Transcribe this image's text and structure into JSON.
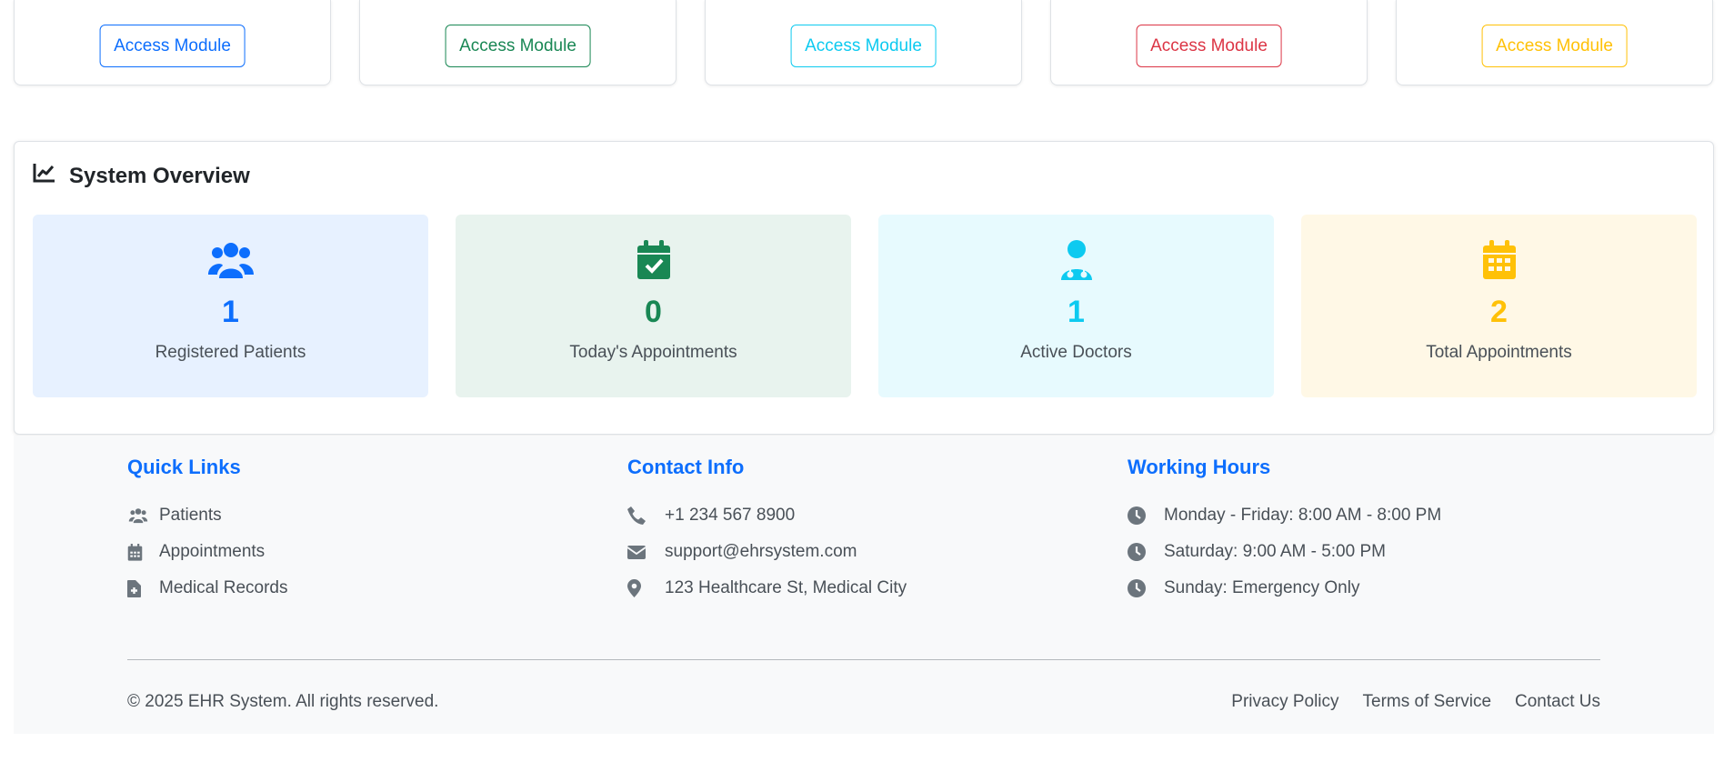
{
  "modules": [
    {
      "button": "Access Module",
      "color": "#0d6efd"
    },
    {
      "button": "Access Module",
      "color": "#198754"
    },
    {
      "button": "Access Module",
      "color": "#0dcaf0"
    },
    {
      "button": "Access Module",
      "color": "#dc3545"
    },
    {
      "button": "Access Module",
      "color": "#ffc107"
    }
  ],
  "overview": {
    "title": "System Overview",
    "icon": "chart-line-icon",
    "stats": [
      {
        "value": "1",
        "label": "Registered Patients",
        "icon": "users-icon",
        "color": "#0d6efd",
        "bg": "#e7f1ff"
      },
      {
        "value": "0",
        "label": "Today's Appointments",
        "icon": "calendar-check-icon",
        "color": "#198754",
        "bg": "#e8f3ee"
      },
      {
        "value": "1",
        "label": "Active Doctors",
        "icon": "doctor-icon",
        "color": "#0dcaf0",
        "bg": "#e7fafe"
      },
      {
        "value": "2",
        "label": "Total Appointments",
        "icon": "calendar-icon",
        "color": "#ffc107",
        "bg": "#fff8e6"
      }
    ]
  },
  "footer": {
    "quick_links": {
      "title": "Quick Links",
      "items": [
        {
          "label": "Patients",
          "icon": "users-icon"
        },
        {
          "label": "Appointments",
          "icon": "calendar-icon"
        },
        {
          "label": "Medical Records",
          "icon": "file-medical-icon"
        }
      ]
    },
    "contact": {
      "title": "Contact Info",
      "items": [
        {
          "label": "+1 234 567 8900",
          "icon": "phone-icon"
        },
        {
          "label": "support@ehrsystem.com",
          "icon": "envelope-icon"
        },
        {
          "label": "123 Healthcare St, Medical City",
          "icon": "map-marker-icon"
        }
      ]
    },
    "hours": {
      "title": "Working Hours",
      "items": [
        {
          "label": "Monday - Friday: 8:00 AM - 8:00 PM",
          "icon": "clock-icon"
        },
        {
          "label": "Saturday: 9:00 AM - 5:00 PM",
          "icon": "clock-icon"
        },
        {
          "label": "Sunday: Emergency Only",
          "icon": "clock-icon"
        }
      ]
    },
    "copyright": "© 2025 EHR System. All rights reserved.",
    "links": [
      "Privacy Policy",
      "Terms of Service",
      "Contact Us"
    ]
  }
}
